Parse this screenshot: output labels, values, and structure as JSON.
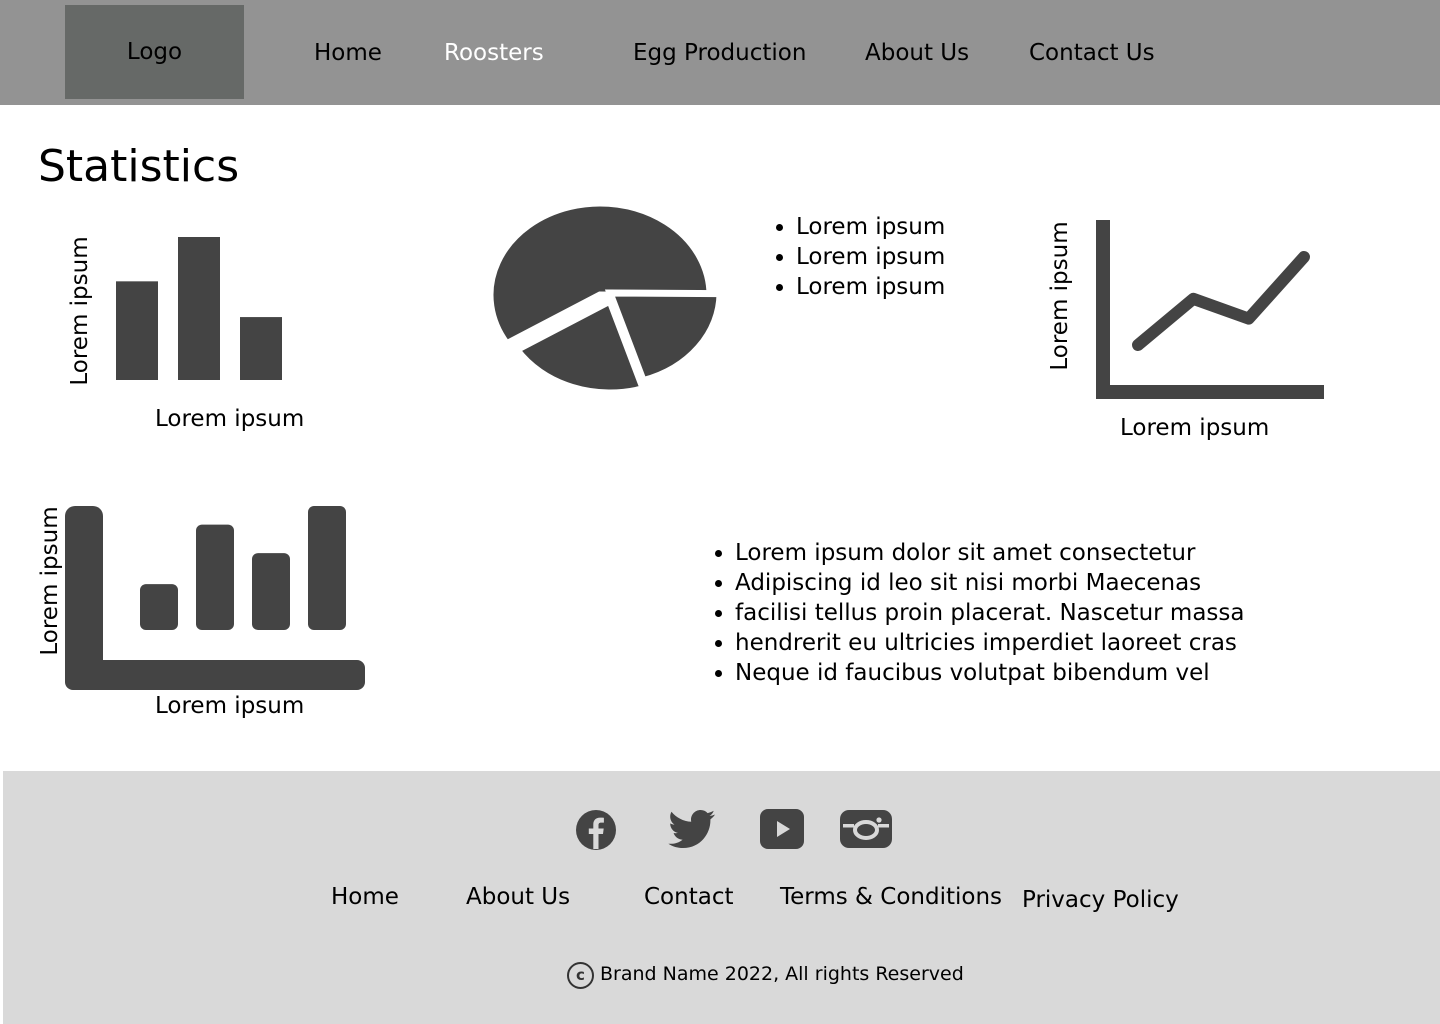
{
  "header": {
    "logo": "Logo",
    "nav": [
      {
        "label": "Home",
        "active": false
      },
      {
        "label": "Roosters",
        "active": true
      },
      {
        "label": "Egg Production",
        "active": false
      },
      {
        "label": "About Us",
        "active": false
      },
      {
        "label": "Contact Us",
        "active": false
      }
    ],
    "active_color": "#ffffff"
  },
  "page": {
    "title": "Statistics"
  },
  "chart_data": [
    {
      "type": "bar",
      "categories": [
        "",
        "",
        ""
      ],
      "values": [
        69,
        100,
        44
      ],
      "xlabel": "Lorem ipsum",
      "ylabel": "Lorem ipsum"
    },
    {
      "type": "pie",
      "values": [
        59,
        20,
        21
      ],
      "legend": [
        "Lorem ipsum",
        "Lorem ipsum",
        "Lorem ipsum"
      ],
      "color": "#444444"
    },
    {
      "type": "line",
      "values": [
        20,
        62,
        44,
        100
      ],
      "xlabel": "Lorem ipsum",
      "ylabel": "Lorem ipsum"
    },
    {
      "type": "bar",
      "categories": [
        "",
        "",
        "",
        ""
      ],
      "values": [
        37,
        85,
        62,
        100
      ],
      "xlabel": "Lorem ipsum",
      "ylabel": "Lorem ipsum"
    }
  ],
  "details": [
    "Lorem ipsum dolor sit amet consectetur",
    "Adipiscing id leo sit nisi morbi Maecenas",
    "facilisi tellus proin placerat. Nascetur massa",
    "hendrerit eu ultricies imperdiet laoreet cras",
    "Neque id faucibus volutpat bibendum vel"
  ],
  "footer": {
    "social": [
      "facebook-icon",
      "twitter-icon",
      "youtube-icon",
      "instagram-icon"
    ],
    "links": [
      "Home",
      "About Us",
      "Contact",
      "Terms & Conditions",
      "Privacy Policy"
    ],
    "copyright_symbol": "c",
    "copyright": "Brand Name 2022, All rights Reserved"
  }
}
